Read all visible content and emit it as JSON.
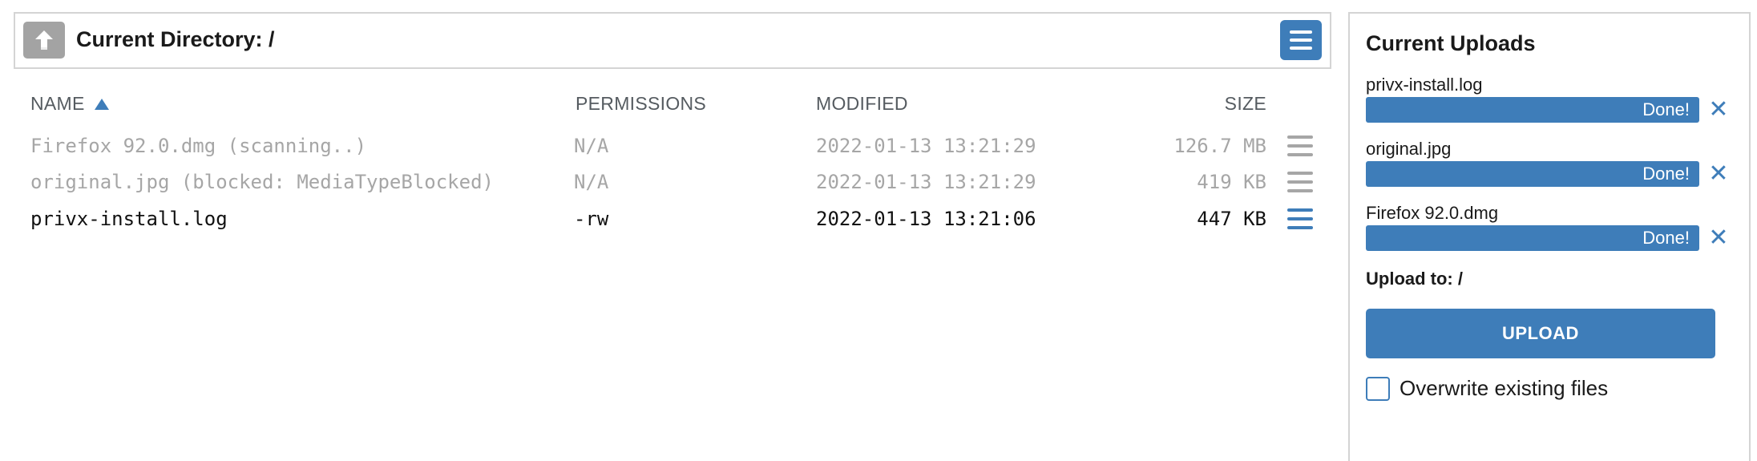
{
  "directory": {
    "title": "Current Directory: /"
  },
  "table": {
    "headers": {
      "name": "NAME",
      "permissions": "PERMISSIONS",
      "modified": "MODIFIED",
      "size": "SIZE"
    },
    "rows": [
      {
        "name": "Firefox 92.0.dmg (scanning..)",
        "permissions": "N/A",
        "modified": "2022-01-13 13:21:29",
        "size": "126.7 MB"
      },
      {
        "name": "original.jpg (blocked: MediaTypeBlocked)",
        "permissions": "N/A",
        "modified": "2022-01-13 13:21:29",
        "size": "419 KB"
      },
      {
        "name": "privx-install.log",
        "permissions": "-rw",
        "modified": "2022-01-13 13:21:06",
        "size": "447 KB"
      }
    ]
  },
  "uploads": {
    "title": "Current Uploads",
    "items": [
      {
        "filename": "privx-install.log",
        "status": "Done!"
      },
      {
        "filename": "original.jpg",
        "status": "Done!"
      },
      {
        "filename": "Firefox 92.0.dmg",
        "status": "Done!"
      }
    ],
    "upload_to": "Upload to: /",
    "upload_button": "UPLOAD",
    "overwrite_label": "Overwrite existing files"
  },
  "colors": {
    "accent": "#3e7db9",
    "muted": "#a6a6a6",
    "border": "#d4d4d4"
  }
}
